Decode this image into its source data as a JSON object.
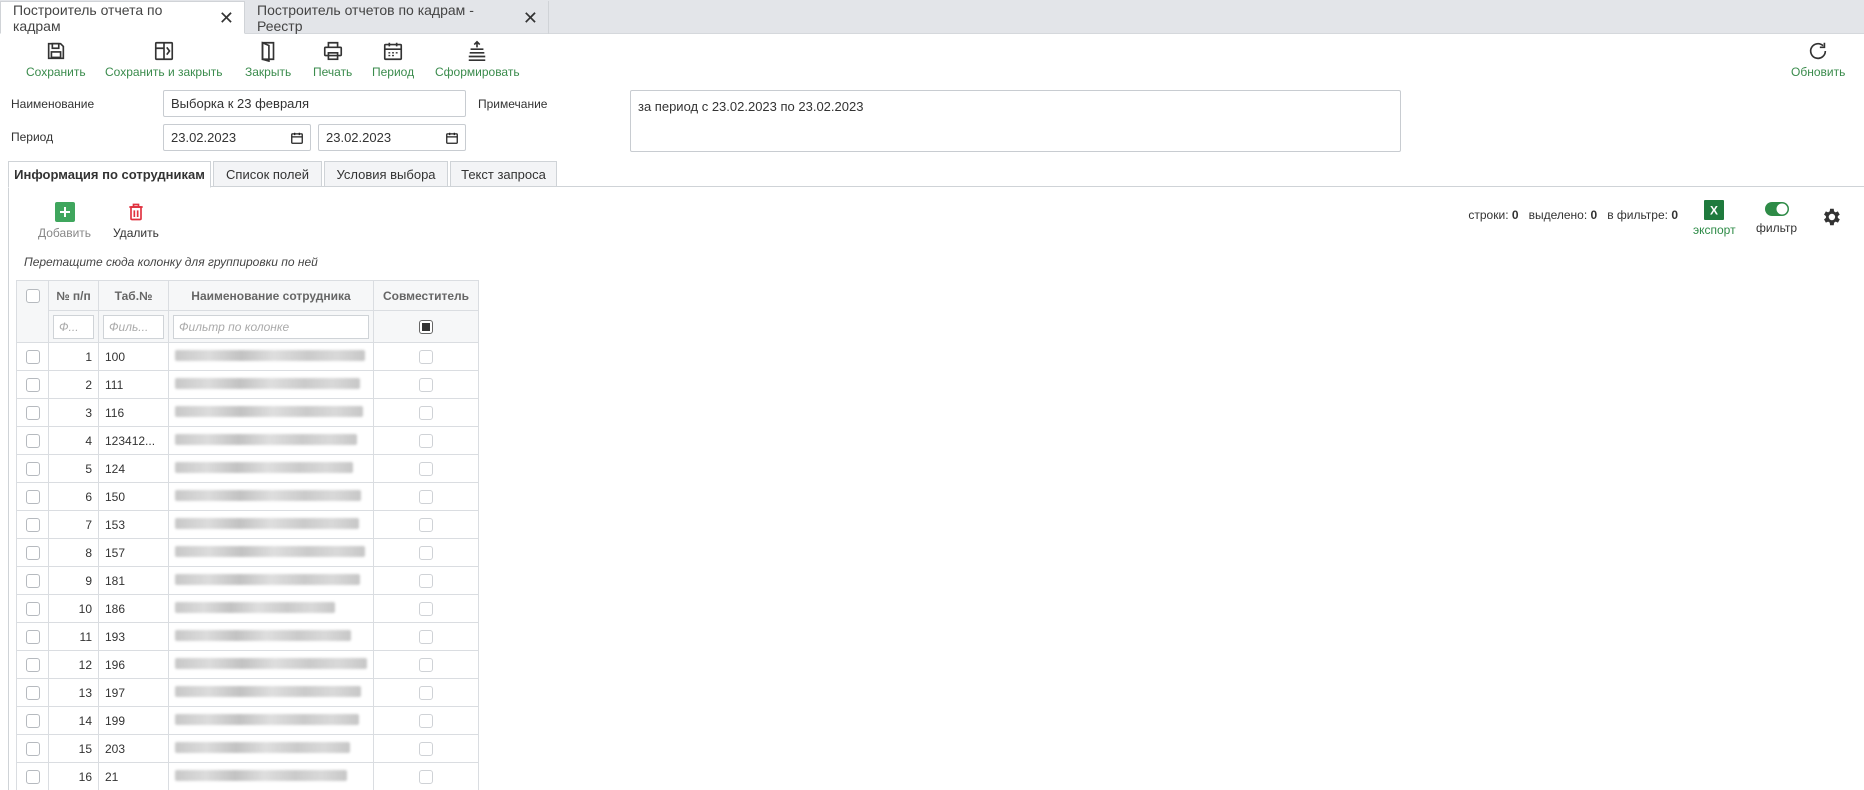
{
  "doc_tabs": [
    {
      "label": "Построитель отчета по кадрам",
      "active": true
    },
    {
      "label": "Построитель отчетов по кадрам - Реестр",
      "active": false
    }
  ],
  "toolbar": {
    "save": "Сохранить",
    "save_close": "Сохранить и закрыть",
    "close": "Закрыть",
    "print": "Печать",
    "period": "Период",
    "generate": "Сформировать",
    "refresh": "Обновить"
  },
  "form": {
    "name_label": "Наименование",
    "name_value": "Выборка к 23 февраля",
    "period_label": "Период",
    "period_from": "23.02.2023",
    "period_to": "23.02.2023",
    "note_label": "Примечание",
    "note_value": "за период с 23.02.2023 по 23.02.2023"
  },
  "section_tabs": [
    {
      "label": "Информация по сотрудникам",
      "active": true
    },
    {
      "label": "Список полей",
      "active": false
    },
    {
      "label": "Условия выбора",
      "active": false
    },
    {
      "label": "Текст запроса",
      "active": false
    }
  ],
  "grid_toolbar": {
    "add": "Добавить",
    "delete": "Удалить",
    "rows_label": "строки:",
    "rows_value": "0",
    "selected_label": "выделено:",
    "selected_value": "0",
    "in_filter_label": "в фильтре:",
    "in_filter_value": "0",
    "export": "экспорт",
    "filter": "фильтр",
    "filter_on": true
  },
  "group_hint": "Перетащите сюда колонку для группировки по ней",
  "table": {
    "columns": [
      "№ п/п",
      "Таб.№",
      "Наименование сотрудника",
      "Совместитель"
    ],
    "filter_placeholders": [
      "Ф...",
      "Филь...",
      "Фильтр по колонке"
    ],
    "rows": [
      {
        "n": "1",
        "tab": "100"
      },
      {
        "n": "2",
        "tab": "111"
      },
      {
        "n": "3",
        "tab": "116"
      },
      {
        "n": "4",
        "tab": "123412..."
      },
      {
        "n": "5",
        "tab": "124"
      },
      {
        "n": "6",
        "tab": "150"
      },
      {
        "n": "7",
        "tab": "153"
      },
      {
        "n": "8",
        "tab": "157"
      },
      {
        "n": "9",
        "tab": "181"
      },
      {
        "n": "10",
        "tab": "186"
      },
      {
        "n": "11",
        "tab": "193"
      },
      {
        "n": "12",
        "tab": "196"
      },
      {
        "n": "13",
        "tab": "197"
      },
      {
        "n": "14",
        "tab": "199"
      },
      {
        "n": "15",
        "tab": "203"
      },
      {
        "n": "16",
        "tab": "21"
      }
    ]
  },
  "colors": {
    "accent_green": "#3a8b4c",
    "delete_red": "#e0313f",
    "add_green": "#3fa65d",
    "excel_green": "#1f7a3d"
  }
}
